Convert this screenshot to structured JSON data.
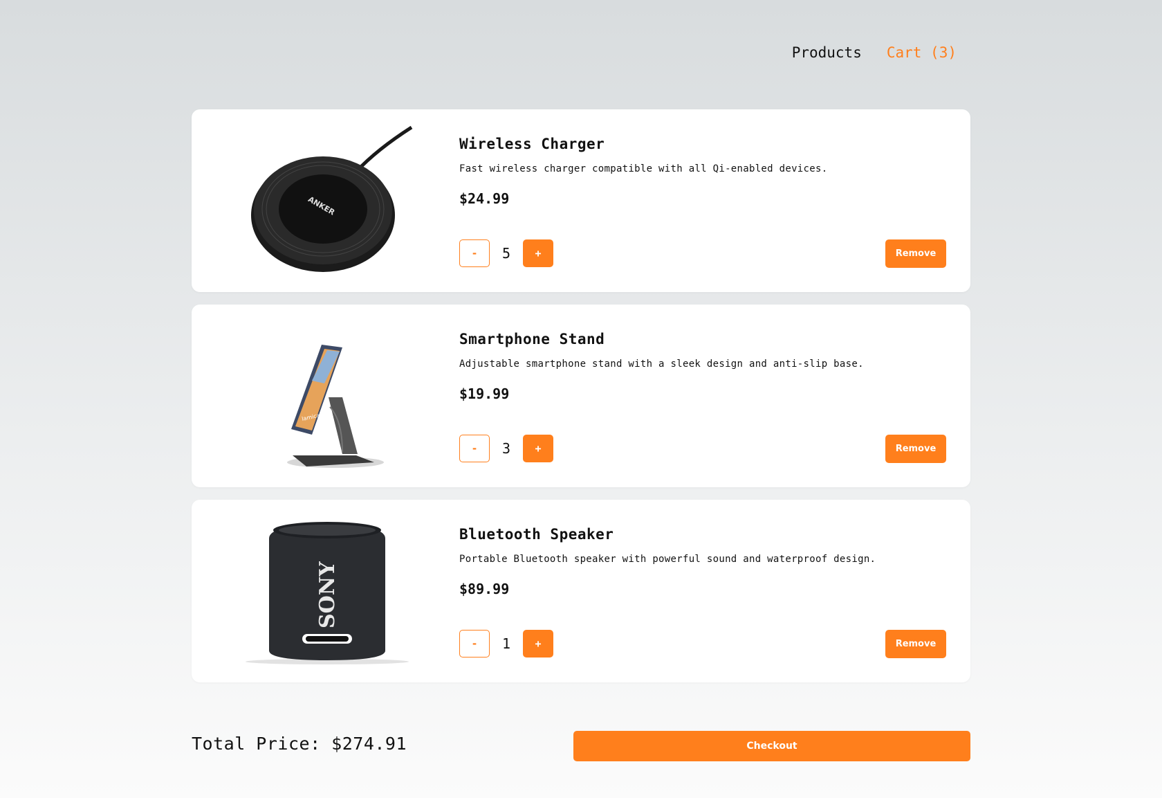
{
  "nav": {
    "products_label": "Products",
    "cart_label": "Cart (3)"
  },
  "cart": {
    "items": [
      {
        "title": "Wireless Charger",
        "description": "Fast wireless charger compatible with all Qi-enabled devices.",
        "price": "$24.99",
        "quantity": "5",
        "image_icon": "wireless-charger-image",
        "image_brand": "ANKER"
      },
      {
        "title": "Smartphone Stand",
        "description": "Adjustable smartphone stand with a sleek design and anti-slip base.",
        "price": "$19.99",
        "quantity": "3",
        "image_icon": "smartphone-stand-image",
        "image_brand": "lamicall"
      },
      {
        "title": "Bluetooth Speaker",
        "description": "Portable Bluetooth speaker with powerful sound and waterproof design.",
        "price": "$89.99",
        "quantity": "1",
        "image_icon": "bluetooth-speaker-image",
        "image_brand": "SONY"
      }
    ],
    "minus_label": "-",
    "plus_label": "+",
    "remove_label": "Remove"
  },
  "summary": {
    "total_text": "Total Price: $274.91",
    "checkout_label": "Checkout"
  },
  "colors": {
    "accent": "#ff7f1c",
    "card_bg": "#ffffff",
    "text": "#111111"
  }
}
